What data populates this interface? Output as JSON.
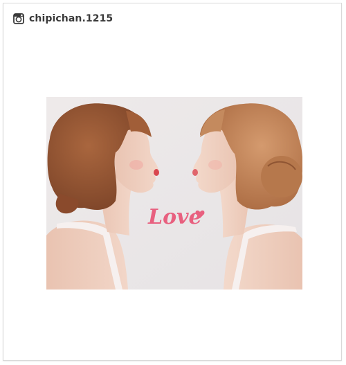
{
  "post": {
    "username": "chipichan.1215",
    "icon": "instagram-icon"
  },
  "photo": {
    "subject": "two women facing each other in profile, kissing pose",
    "overlay_text": "Love",
    "overlay_color": "#e8607f",
    "background_color": "#ece9ea"
  }
}
